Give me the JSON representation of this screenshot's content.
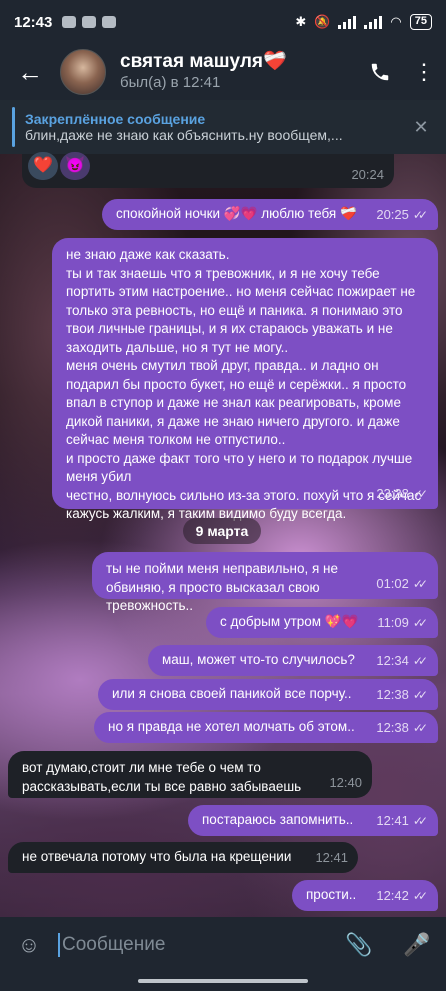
{
  "status_bar": {
    "time": "12:43",
    "battery": "75"
  },
  "header": {
    "back_icon": "arrow-left",
    "name": "святая машуля❤️‍🩹",
    "status": "был(а) в 12:41",
    "call_icon": "phone",
    "menu_icon": "more-vertical"
  },
  "pinned": {
    "title": "Закреплённое сообщение",
    "text": "блин,даже не знаю как объяснить.ну вообщем,..."
  },
  "reactions": {
    "time": "20:24",
    "emojis": [
      "❤️",
      "😈"
    ]
  },
  "messages": [
    {
      "dir": "out",
      "text": "спокойной ночки 💞💗 люблю тебя ❤️‍🩹",
      "time": "20:25"
    },
    {
      "dir": "out",
      "text": "не знаю даже как сказать.\nты и так знаешь что я тревожник, и я не хочу тебе портить этим настроение.. но меня сейчас пожирает не только эта ревность, но ещё и паника. я понимаю это твои личные границы, и я их стараюсь уважать и не заходить дальше, но я тут не могу..\nменя очень смутил твой друг, правда.. и ладно он подарил бы просто букет, но ещё и серёжки.. я просто впал в ступор и даже не знал как реагировать, кроме дикой паники, я даже не знаю ничего другого. и даже сейчас меня толком не отпустило..\nи просто даже факт того что у него и то подарок лучше меня убил\nчестно, волнуюсь сильно из-за этого. похуй что я сейчас кажусь жалким, я таким видимо буду всегда.",
      "time": "23:38"
    },
    {
      "dir": "out",
      "text": "ты не пойми меня неправильно, я не обвиняю, я просто высказал свою тревожность..",
      "time": "01:02"
    },
    {
      "dir": "out",
      "text": "с добрым утром 💖💗",
      "time": "11:09"
    },
    {
      "dir": "out",
      "text": "маш, может что-то случилось?",
      "time": "12:34"
    },
    {
      "dir": "out",
      "text": "или я снова своей паникой все порчу..",
      "time": "12:38"
    },
    {
      "dir": "out",
      "text": "но я правда не хотел молчать об этом..",
      "time": "12:38"
    },
    {
      "dir": "in",
      "text": "вот думаю,стоит ли мне тебе о чем то рассказывать,если ты все равно забываешь",
      "time": "12:40"
    },
    {
      "dir": "out",
      "text": "постараюсь запомнить..",
      "time": "12:41"
    },
    {
      "dir": "in",
      "text": "не отвечала потому что была на крещении",
      "time": "12:41"
    },
    {
      "dir": "out",
      "text": "прости..",
      "time": "12:42"
    }
  ],
  "date_separator": "9 марта",
  "input": {
    "placeholder": "Сообщение",
    "emoji_icon": "emoji",
    "attach_icon": "paperclip",
    "mic_icon": "microphone"
  }
}
